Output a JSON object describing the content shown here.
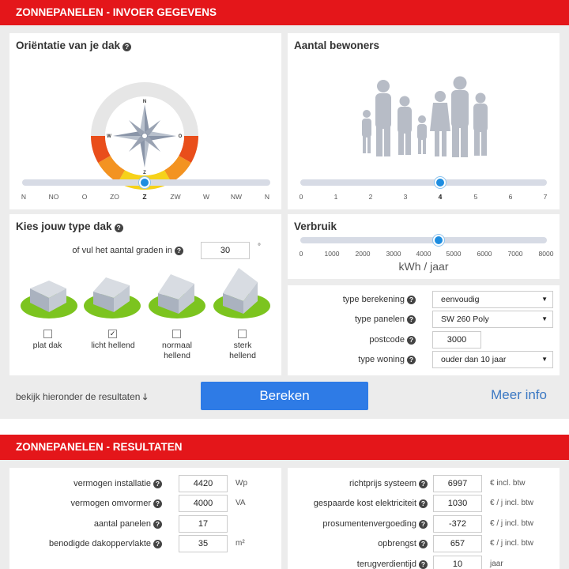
{
  "invoer": {
    "header": "ZONNEPANELEN - INVOER GEGEVENS",
    "orientatie": {
      "title": "Oriëntatie van je dak",
      "compass": {
        "n": "N",
        "z": "Z",
        "o": "O",
        "w": "W"
      },
      "ticks": [
        "N",
        "NO",
        "O",
        "ZO",
        "Z",
        "ZW",
        "W",
        "NW",
        "N"
      ],
      "selected": "Z",
      "selected_index": 4
    },
    "bewoners": {
      "title": "Aantal bewoners",
      "ticks": [
        "0",
        "1",
        "2",
        "3",
        "4",
        "5",
        "6",
        "7"
      ],
      "value": 4
    },
    "type_dak": {
      "title": "Kies jouw type dak",
      "graden_label": "of vul het aantal graden in",
      "graden_value": "30",
      "graden_unit": "°",
      "options": [
        {
          "label1": "plat dak",
          "label2": "",
          "checked": false,
          "mark": ""
        },
        {
          "label1": "licht hellend",
          "label2": "",
          "checked": true,
          "mark": "✓"
        },
        {
          "label1": "normaal",
          "label2": "hellend",
          "checked": false,
          "mark": ""
        },
        {
          "label1": "sterk",
          "label2": "hellend",
          "checked": false,
          "mark": ""
        }
      ]
    },
    "verbruik": {
      "title": "Verbruik",
      "ticks": [
        "0",
        "1000",
        "2000",
        "3000",
        "4000",
        "5000",
        "6000",
        "7000",
        "8000"
      ],
      "value": 4500,
      "max": 8000,
      "unit": "kWh / jaar"
    },
    "form": {
      "type_berekening": {
        "label": "type berekening",
        "value": "eenvoudig"
      },
      "type_panelen": {
        "label": "type panelen",
        "value": "SW 260 Poly"
      },
      "postcode": {
        "label": "postcode",
        "value": "3000"
      },
      "type_woning": {
        "label": "type woning",
        "value": "ouder dan 10 jaar"
      }
    },
    "footer": {
      "hint": "bekijk hieronder de resultaten",
      "bereken": "Bereken",
      "meer_info": "Meer info"
    }
  },
  "resultaten": {
    "header": "ZONNEPANELEN - RESULTATEN",
    "left": [
      {
        "label": "vermogen installatie",
        "value": "4420",
        "unit": "Wp"
      },
      {
        "label": "vermogen omvormer",
        "value": "4000",
        "unit": "VA"
      },
      {
        "label": "aantal panelen",
        "value": "17",
        "unit": ""
      },
      {
        "label": "benodigde dakoppervlakte",
        "value": "35",
        "unit": "m²"
      }
    ],
    "right": [
      {
        "label": "richtprijs systeem",
        "value": "6997",
        "unit": "€ incl. btw"
      },
      {
        "label": "gespaarde kost elektriciteit",
        "value": "1030",
        "unit": "€ / j incl. btw"
      },
      {
        "label": "prosumentenvergoeding",
        "value": "-372",
        "unit": "€ / j incl. btw"
      },
      {
        "label": "opbrengst",
        "value": "657",
        "unit": "€ / j incl. btw"
      },
      {
        "label": "terugverdientijd",
        "value": "10",
        "unit": "jaar"
      }
    ]
  },
  "colors": {
    "header_red": "#e4161a",
    "accent_blue": "#1e8de0",
    "button_blue": "#2e7be6",
    "link_blue": "#3b78c3"
  }
}
